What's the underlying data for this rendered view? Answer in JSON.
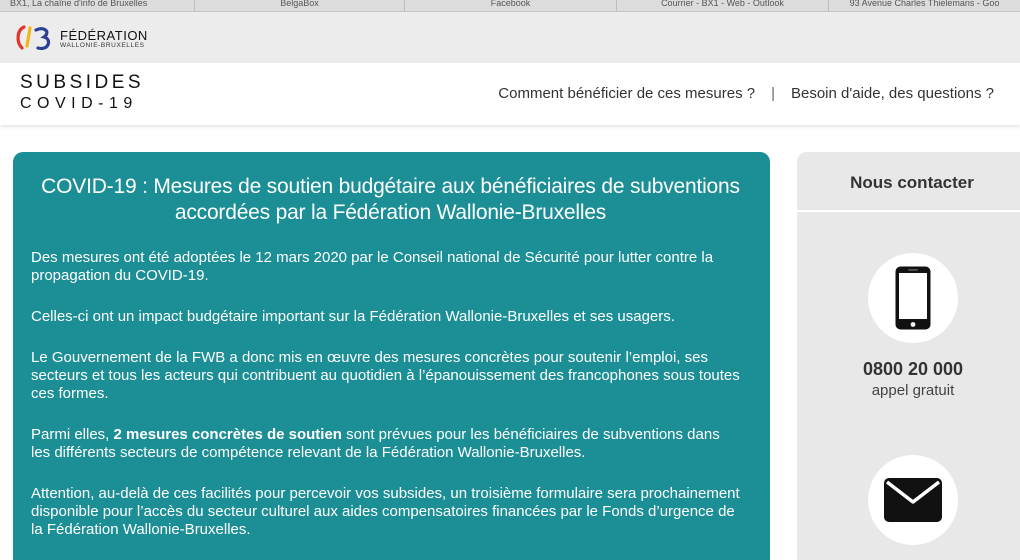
{
  "bookmarks": [
    "BX1, La chaîne d'info de Bruxelles",
    "BelgaBox",
    "Facebook",
    "Courrier - BX1 - Web - Outlook",
    "93 Avenue Charles Thielemans - Goo"
  ],
  "logo": {
    "name": "FÉDÉRATION",
    "subname": "WALLONIE-BRUXELLES",
    "colors": {
      "red": "#e4342a",
      "yellow": "#f3b416",
      "blue": "#2b3f95"
    }
  },
  "header": {
    "brand_line1": "SUBSIDES",
    "brand_line2": "COVID-19",
    "nav": {
      "how": "Comment bénéficier de ces mesures ?",
      "separator": "|",
      "help": "Besoin d'aide, des questions ?"
    }
  },
  "main": {
    "title": "COVID-19 : Mesures de soutien budgétaire aux bénéficiaires de subventions accordées par la Fédération Wallonie-Bruxelles",
    "p1": "Des mesures ont été adoptées le 12 mars 2020 par le Conseil national de Sécurité pour lutter contre la propagation du COVID-19.",
    "p2": "Celles-ci ont un impact budgétaire important sur la Fédération Wallonie-Bruxelles et ses usagers.",
    "p3": "Le Gouvernement de la FWB a donc mis en œuvre des mesures concrètes pour soutenir l’emploi, ses secteurs et tous les acteurs qui contribuent au quotidien à l’épanouissement des francophones sous toutes ces formes.",
    "p4_before": "Parmi elles, ",
    "p4_bold": "2 mesures concrètes de soutien",
    "p4_after": " sont prévues pour les bénéficiaires de subventions dans les différents secteurs de compétence relevant de la Fédération Wallonie-Bruxelles.",
    "p5": "Attention, au-delà de ces facilités pour percevoir vos subsides, un troisième formulaire sera prochainement disponible pour l’accès du secteur culturel aux aides compensatoires financées par le Fonds d’urgence de la Fédération Wallonie-Bruxelles."
  },
  "contact": {
    "title": "Nous contacter",
    "phone_number": "0800 20 000",
    "phone_note": "appel gratuit"
  },
  "colors": {
    "teal": "#1c8f96",
    "side_bg": "#e8e8e8"
  },
  "icons": {
    "phone": "smartphone-icon",
    "mail": "envelope-icon"
  }
}
